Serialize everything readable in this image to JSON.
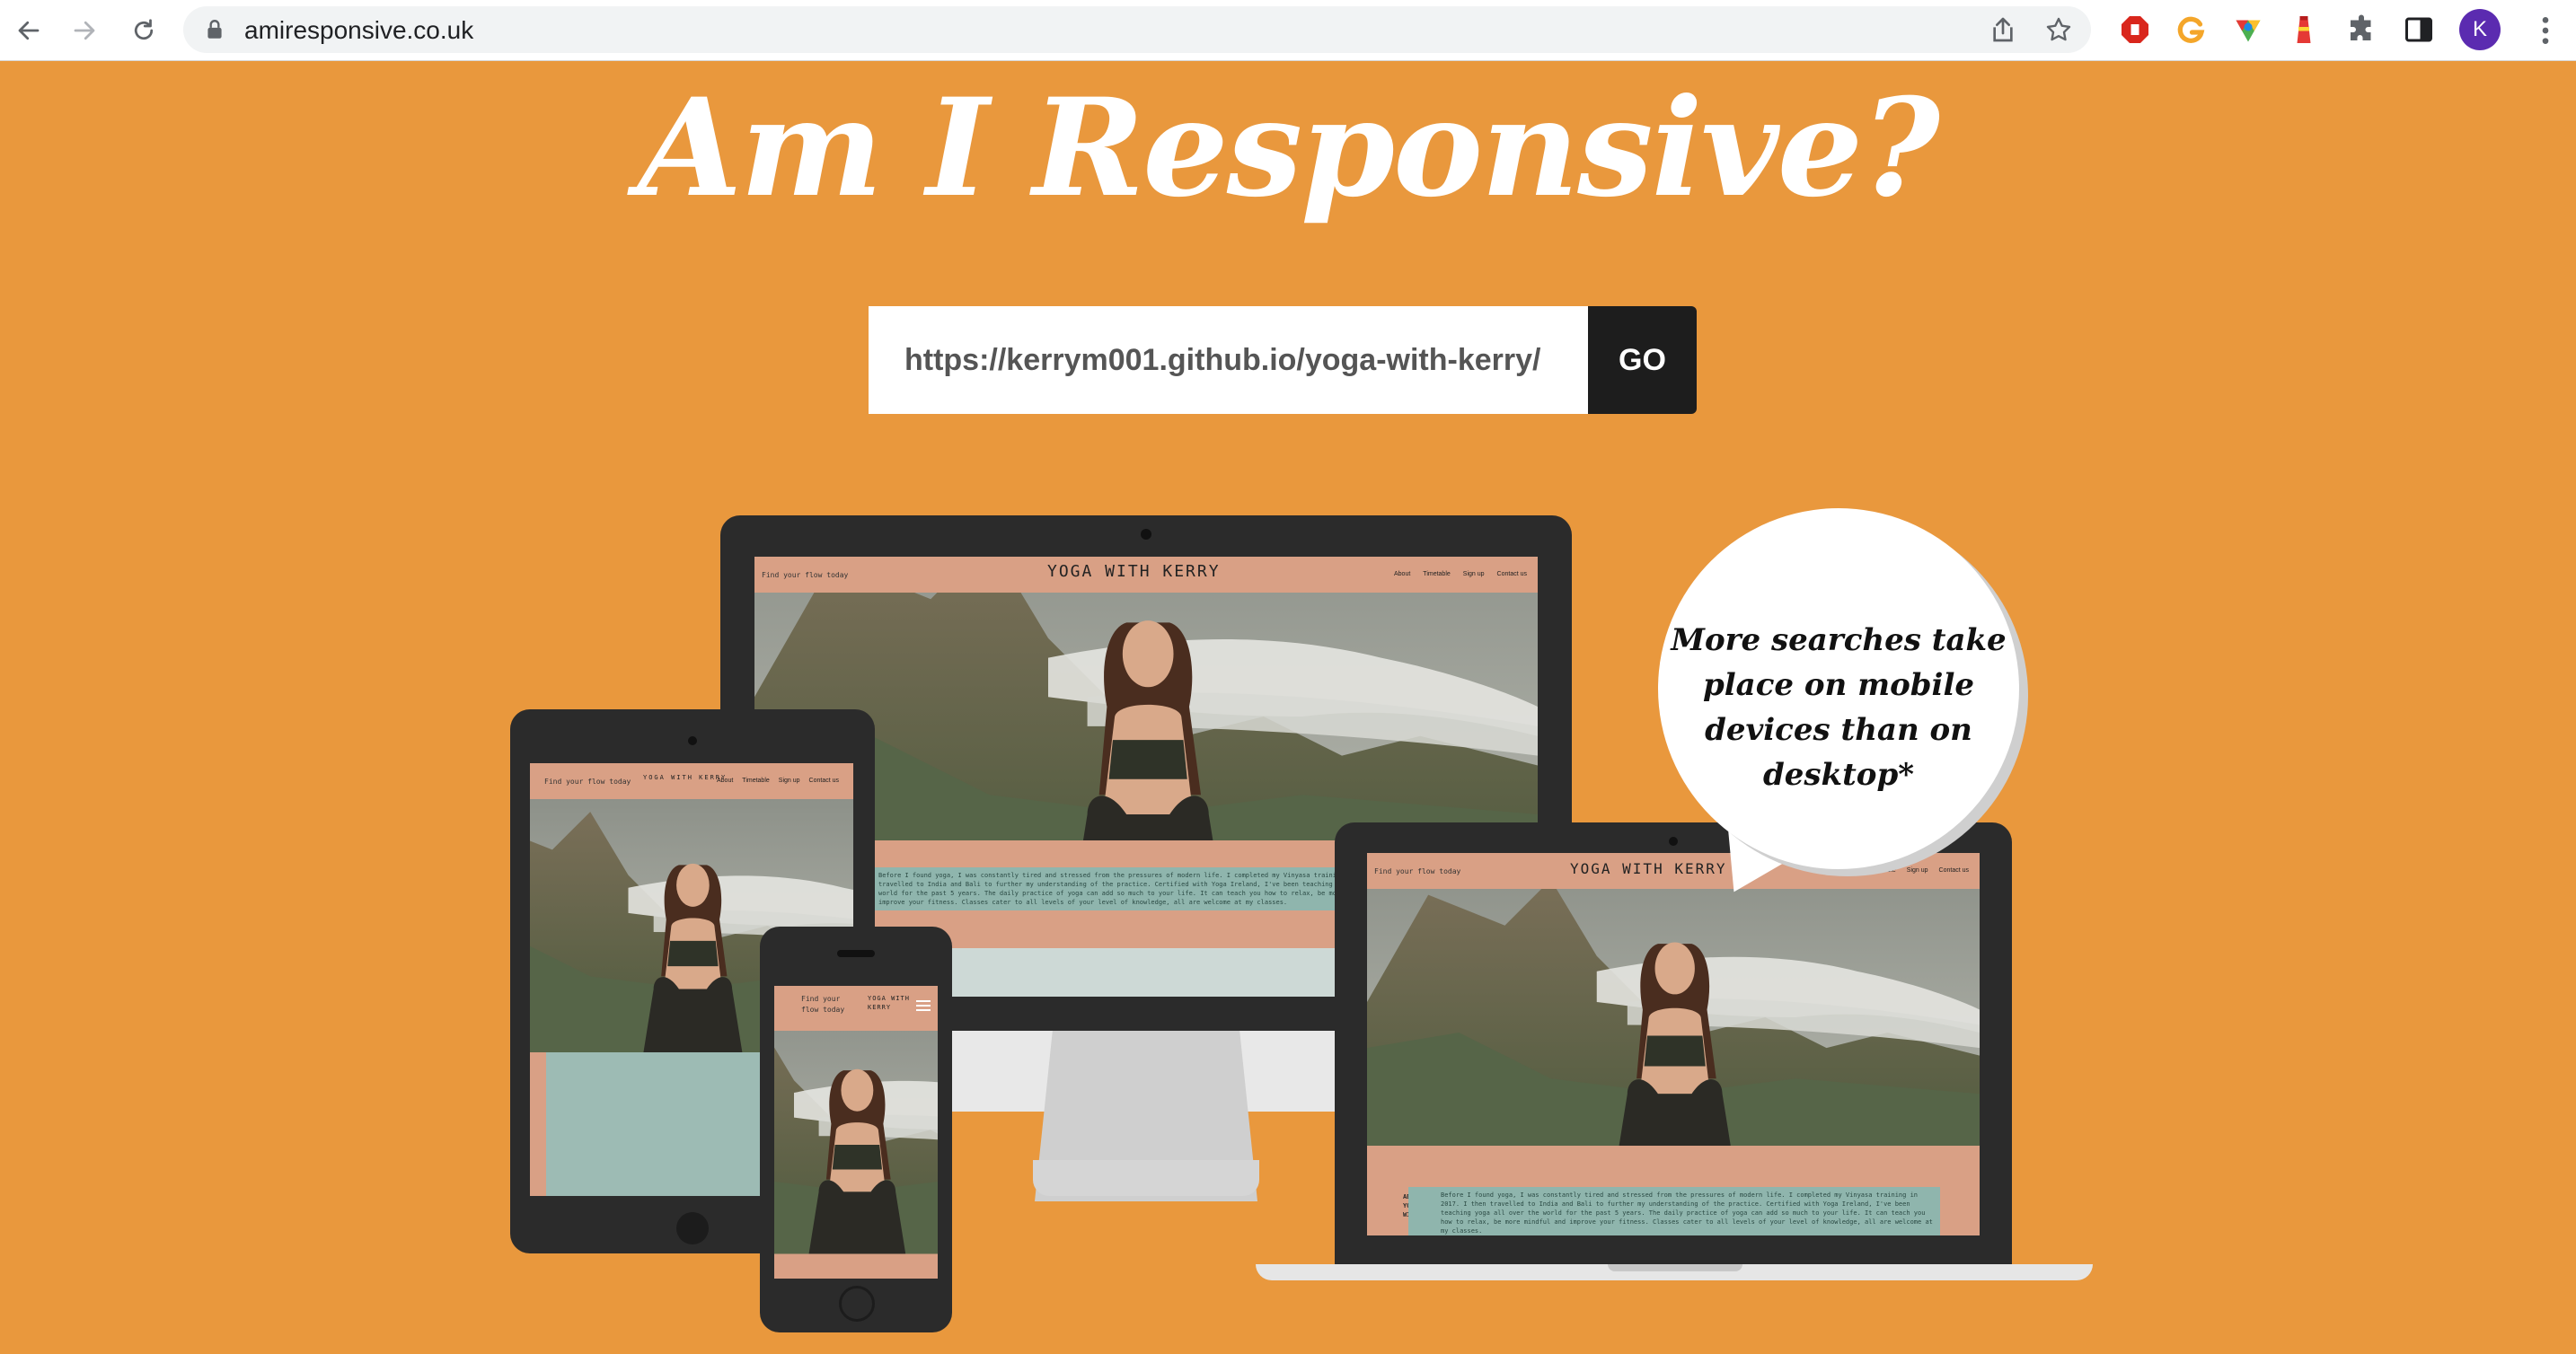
{
  "browser": {
    "url": "amiresponsive.co.uk",
    "profile_initial": "K"
  },
  "page": {
    "title": "Am I Responsive?",
    "url_input_value": "https://kerrym001.github.io/yoga-with-kerry/",
    "go_label": "GO",
    "bubble_text": "More searches take place on mobile devices than on desktop*"
  },
  "site_preview": {
    "tagline": "Find your flow today",
    "brand": "YOGA WITH KERRY",
    "phone_tagline_line1": "Find your",
    "phone_tagline_line2": "flow today",
    "phone_brand_line1": "YOGA WITH",
    "phone_brand_line2": "KERRY",
    "nav": [
      "About",
      "Timetable",
      "Sign up",
      "Contact us"
    ],
    "about_label_line1": "ABOUT",
    "about_label_line2": "YOGA",
    "about_label_line3": "WITH",
    "about_text": "Before I found yoga, I was constantly tired and stressed from the pressures of modern life. I completed my Vinyasa training in 2017. I then travelled to India and Bali to further my understanding of the practice. Certified with Yoga Ireland, I've been teaching yoga all over the world for the past 5 years. The daily practice of yoga can add so much to your life. It can teach you how to relax, be more mindful and improve your fitness. Classes cater to all levels of your level of knowledge, all are welcome at my classes."
  },
  "colors": {
    "page_bg": "#E9983D",
    "site_header": "#D9A085",
    "site_about": "#8FB5AD",
    "device": "#2b2b2b"
  }
}
